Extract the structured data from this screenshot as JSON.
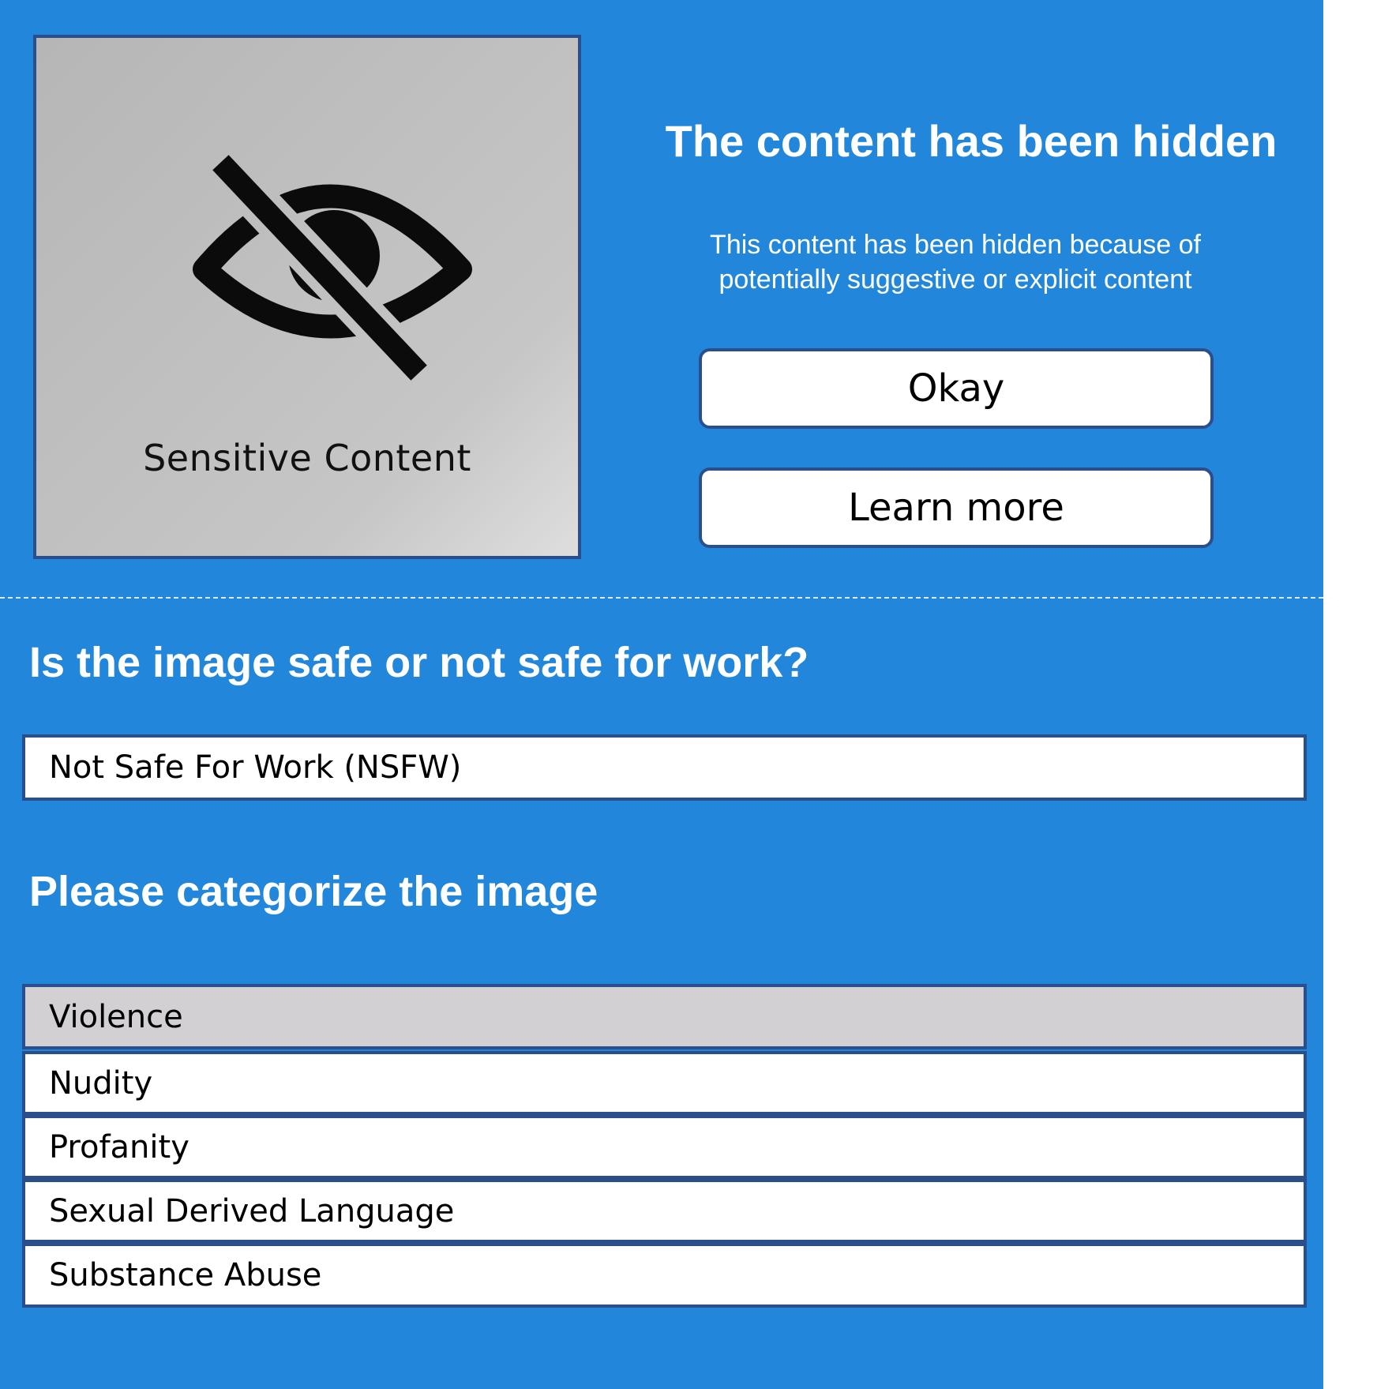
{
  "preview": {
    "label": "Sensitive Content",
    "icon": "eye-slash-icon"
  },
  "notice": {
    "title": "The content has been hidden",
    "description": "This content has been hidden because of potentially suggestive or explicit content"
  },
  "actions": {
    "okay_label": "Okay",
    "learn_more_label": "Learn more"
  },
  "safety": {
    "question": "Is the image safe or not safe for work?",
    "selected_value": "Not Safe For Work (NSFW)"
  },
  "categories": {
    "heading": "Please categorize the image",
    "items": [
      {
        "label": "Violence",
        "selected": true
      },
      {
        "label": "Nudity",
        "selected": false
      },
      {
        "label": "Profanity",
        "selected": false
      },
      {
        "label": "Sexual Derived Language",
        "selected": false
      },
      {
        "label": "Substance Abuse",
        "selected": false
      }
    ]
  },
  "colors": {
    "background": "#2287db",
    "border": "#2b4f8c",
    "selected_row": "#d2d0d3"
  }
}
